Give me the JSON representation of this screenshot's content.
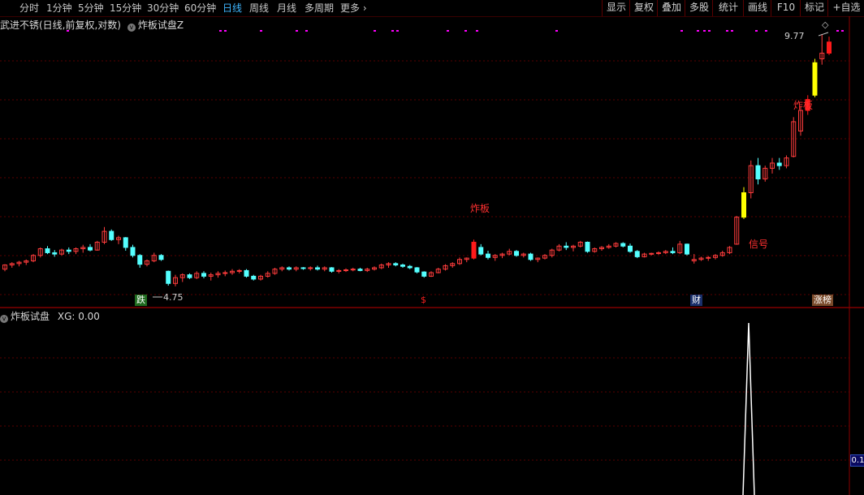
{
  "toolbar": {
    "periods": [
      "分时",
      "1分钟",
      "5分钟",
      "15分钟",
      "30分钟",
      "60分钟",
      "日线",
      "周线",
      "月线",
      "多周期",
      "更多"
    ],
    "active_period": "日线",
    "buttons": [
      "显示",
      "复权",
      "叠加",
      "多股",
      "统计",
      "画线",
      "F10",
      "标记",
      "+自选"
    ]
  },
  "main_chart": {
    "title": "武进不锈(日线,前复权,对数)",
    "indicator_name": "炸板试盘Z",
    "high_label": "9.77",
    "low_label": "4.75",
    "markers": {
      "die": "跌",
      "dollar": "$",
      "cai": "财",
      "zhangbang": "涨榜"
    },
    "annotations": {
      "zhaban_1": "炸板",
      "zhaban_2": "炸板",
      "xinhao": "信号"
    }
  },
  "sub_chart": {
    "title": "炸板试盘",
    "xg_label": "XG: 0.00",
    "axis_value": "0.1"
  },
  "colors": {
    "up": "#ff3c3c",
    "down": "#54ffff",
    "signal": "#ffff00",
    "zhaban": "#ff1a1a",
    "grid": "#5a0000",
    "dot": "#ff00ff"
  },
  "chart_data": {
    "type": "candlestick",
    "ohlc": [
      [
        4.98,
        5.05,
        4.95,
        5.04
      ],
      [
        5.04,
        5.08,
        5.0,
        5.06
      ],
      [
        5.06,
        5.1,
        5.02,
        5.08
      ],
      [
        5.08,
        5.12,
        5.04,
        5.1
      ],
      [
        5.1,
        5.2,
        5.08,
        5.18
      ],
      [
        5.18,
        5.3,
        5.15,
        5.28
      ],
      [
        5.28,
        5.32,
        5.2,
        5.22
      ],
      [
        5.22,
        5.26,
        5.16,
        5.2
      ],
      [
        5.2,
        5.28,
        5.18,
        5.26
      ],
      [
        5.26,
        5.3,
        5.2,
        5.24
      ],
      [
        5.24,
        5.3,
        5.2,
        5.28
      ],
      [
        5.28,
        5.34,
        5.22,
        5.3
      ],
      [
        5.3,
        5.35,
        5.24,
        5.26
      ],
      [
        5.26,
        5.4,
        5.25,
        5.38
      ],
      [
        5.38,
        5.62,
        5.35,
        5.55
      ],
      [
        5.55,
        5.58,
        5.4,
        5.42
      ],
      [
        5.42,
        5.48,
        5.35,
        5.45
      ],
      [
        5.45,
        5.46,
        5.25,
        5.3
      ],
      [
        5.3,
        5.34,
        5.15,
        5.18
      ],
      [
        5.18,
        5.2,
        5.0,
        5.05
      ],
      [
        5.05,
        5.12,
        5.02,
        5.1
      ],
      [
        5.1,
        5.22,
        5.08,
        5.18
      ],
      [
        5.18,
        5.2,
        5.1,
        5.12
      ],
      [
        4.95,
        4.96,
        4.75,
        4.78
      ],
      [
        4.78,
        4.9,
        4.74,
        4.86
      ],
      [
        4.86,
        4.92,
        4.8,
        4.9
      ],
      [
        4.9,
        4.92,
        4.84,
        4.86
      ],
      [
        4.86,
        4.95,
        4.84,
        4.92
      ],
      [
        4.92,
        4.95,
        4.85,
        4.88
      ],
      [
        4.88,
        4.93,
        4.82,
        4.9
      ],
      [
        4.9,
        4.95,
        4.86,
        4.92
      ],
      [
        4.92,
        4.96,
        4.88,
        4.93
      ],
      [
        4.93,
        4.98,
        4.9,
        4.95
      ],
      [
        4.95,
        4.98,
        4.92,
        4.96
      ],
      [
        4.96,
        4.98,
        4.86,
        4.88
      ],
      [
        4.88,
        4.9,
        4.82,
        4.84
      ],
      [
        4.84,
        4.9,
        4.82,
        4.88
      ],
      [
        4.88,
        4.95,
        4.86,
        4.92
      ],
      [
        4.92,
        5.0,
        4.9,
        4.98
      ],
      [
        4.98,
        5.02,
        4.95,
        5.0
      ],
      [
        5.0,
        5.02,
        4.96,
        4.98
      ],
      [
        4.98,
        5.02,
        4.95,
        5.0
      ],
      [
        5.0,
        5.01,
        4.97,
        4.99
      ],
      [
        4.99,
        5.02,
        4.96,
        5.0
      ],
      [
        5.0,
        5.03,
        4.96,
        4.98
      ],
      [
        4.98,
        5.02,
        4.95,
        5.0
      ],
      [
        5.0,
        5.01,
        4.93,
        4.95
      ],
      [
        4.95,
        4.98,
        4.92,
        4.96
      ],
      [
        4.96,
        4.99,
        4.94,
        4.97
      ],
      [
        4.97,
        5.0,
        4.95,
        4.98
      ],
      [
        4.98,
        5.0,
        4.95,
        4.96
      ],
      [
        4.96,
        5.0,
        4.94,
        4.98
      ],
      [
        4.98,
        5.02,
        4.96,
        5.0
      ],
      [
        5.0,
        5.06,
        4.98,
        5.04
      ],
      [
        5.04,
        5.08,
        5.0,
        5.06
      ],
      [
        5.06,
        5.08,
        5.02,
        5.04
      ],
      [
        5.04,
        5.06,
        5.0,
        5.02
      ],
      [
        5.02,
        5.04,
        4.98,
        5.0
      ],
      [
        5.0,
        5.01,
        4.92,
        4.94
      ],
      [
        4.94,
        4.95,
        4.86,
        4.88
      ],
      [
        4.88,
        4.95,
        4.87,
        4.93
      ],
      [
        4.93,
        5.0,
        4.92,
        4.98
      ],
      [
        4.98,
        5.05,
        4.96,
        5.03
      ],
      [
        5.03,
        5.08,
        5.0,
        5.06
      ],
      [
        5.06,
        5.15,
        5.04,
        5.12
      ],
      [
        5.12,
        5.15,
        5.08,
        5.14
      ],
      [
        5.14,
        5.42,
        5.12,
        5.38
      ],
      [
        5.3,
        5.35,
        5.18,
        5.2
      ],
      [
        5.2,
        5.25,
        5.12,
        5.15
      ],
      [
        5.15,
        5.2,
        5.1,
        5.18
      ],
      [
        5.18,
        5.22,
        5.14,
        5.2
      ],
      [
        5.2,
        5.28,
        5.18,
        5.24
      ],
      [
        5.24,
        5.26,
        5.16,
        5.18
      ],
      [
        5.18,
        5.22,
        5.15,
        5.2
      ],
      [
        5.2,
        5.22,
        5.1,
        5.12
      ],
      [
        5.12,
        5.15,
        5.08,
        5.14
      ],
      [
        5.14,
        5.2,
        5.12,
        5.18
      ],
      [
        5.18,
        5.28,
        5.15,
        5.26
      ],
      [
        5.26,
        5.35,
        5.24,
        5.32
      ],
      [
        5.32,
        5.38,
        5.26,
        5.3
      ],
      [
        5.3,
        5.34,
        5.24,
        5.32
      ],
      [
        5.32,
        5.4,
        5.3,
        5.38
      ],
      [
        5.38,
        5.39,
        5.22,
        5.24
      ],
      [
        5.24,
        5.3,
        5.22,
        5.28
      ],
      [
        5.28,
        5.32,
        5.25,
        5.3
      ],
      [
        5.3,
        5.35,
        5.28,
        5.32
      ],
      [
        5.32,
        5.38,
        5.3,
        5.36
      ],
      [
        5.36,
        5.38,
        5.3,
        5.32
      ],
      [
        5.32,
        5.36,
        5.22,
        5.24
      ],
      [
        5.24,
        5.26,
        5.14,
        5.16
      ],
      [
        5.16,
        5.22,
        5.15,
        5.2
      ],
      [
        5.2,
        5.22,
        5.18,
        5.21
      ],
      [
        5.21,
        5.24,
        5.19,
        5.22
      ],
      [
        5.22,
        5.26,
        5.2,
        5.24
      ],
      [
        5.24,
        5.3,
        5.2,
        5.22
      ],
      [
        5.22,
        5.4,
        5.2,
        5.35
      ],
      [
        5.35,
        5.36,
        5.18,
        5.2
      ],
      [
        5.1,
        5.2,
        5.06,
        5.12
      ],
      [
        5.12,
        5.16,
        5.1,
        5.14
      ],
      [
        5.14,
        5.17,
        5.1,
        5.15
      ],
      [
        5.15,
        5.2,
        5.12,
        5.18
      ],
      [
        5.18,
        5.25,
        5.16,
        5.22
      ],
      [
        5.22,
        5.32,
        5.2,
        5.3
      ],
      [
        5.35,
        5.8,
        5.34,
        5.78
      ],
      [
        5.78,
        6.3,
        5.75,
        6.2
      ],
      [
        6.2,
        6.8,
        6.1,
        6.7
      ],
      [
        6.7,
        6.85,
        6.35,
        6.45
      ],
      [
        6.45,
        6.7,
        6.4,
        6.65
      ],
      [
        6.65,
        6.85,
        6.55,
        6.75
      ],
      [
        6.75,
        6.85,
        6.62,
        6.7
      ],
      [
        6.7,
        6.9,
        6.65,
        6.85
      ],
      [
        6.88,
        7.7,
        6.86,
        7.6
      ],
      [
        7.4,
        7.95,
        7.3,
        7.85
      ],
      [
        7.85,
        8.2,
        7.75,
        8.1
      ],
      [
        8.2,
        9.1,
        8.15,
        9.0
      ],
      [
        9.1,
        9.77,
        8.95,
        9.25
      ],
      [
        9.25,
        9.7,
        9.2,
        9.55
      ]
    ]
  }
}
